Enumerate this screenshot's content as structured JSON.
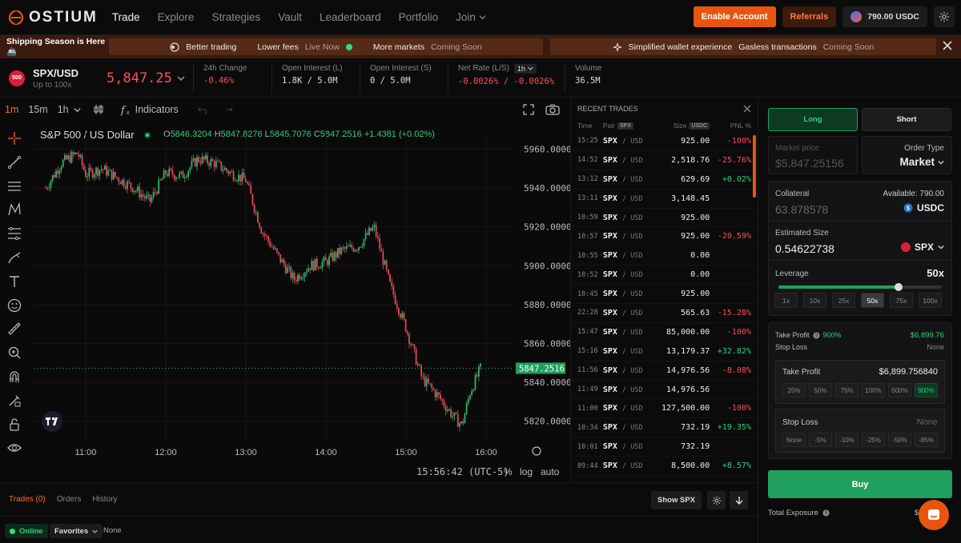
{
  "nav": {
    "logo": "OSTIUM",
    "items": [
      "Trade",
      "Explore",
      "Strategies",
      "Vault",
      "Leaderboard",
      "Portfolio"
    ],
    "join": "Join",
    "enable_account": "Enable Account",
    "referrals": "Referrals",
    "wallet": "790.00 USDC"
  },
  "banner": {
    "left": "Shipping Season is Here 🚢",
    "p1": {
      "a": "Better trading",
      "b": "Lower fees",
      "c": "Live Now",
      "d": "More markets",
      "e": "Coming Soon"
    },
    "p2": {
      "a": "Simplified wallet experience",
      "b": "Gasless transactions",
      "c": "Coming Soon"
    }
  },
  "market": {
    "icon": "500",
    "pair": "SPX/USD",
    "sub": "Up to 100x",
    "price": "5,847.25",
    "stats": [
      {
        "label": "24h Change",
        "value": "-0.46%"
      },
      {
        "label": "Open Interest (L)",
        "value": "1.8K / 5.0M"
      },
      {
        "label": "Open Interest (S)",
        "value": "0 / 5.0M"
      },
      {
        "label": "Net Rate (L/S)",
        "value": "-0.0026% / -0.0026%",
        "badge": "1h"
      },
      {
        "label": "Volume",
        "value": "36.5M"
      }
    ]
  },
  "chart": {
    "timeframes": [
      "1m",
      "15m",
      "1h"
    ],
    "indicators": "Indicators",
    "title": "S&P 500 / US Dollar",
    "ohlc": {
      "o": "5846.3204",
      "h": "5847.8276",
      "l": "5845.7076",
      "c": "5847.2516",
      "chg": "+1.4381 (+0.02%)"
    },
    "last_price": "5847.2516",
    "time": "15:56:42 (UTC-5)",
    "opt_pct": "%",
    "opt_log": "log",
    "opt_auto": "auto"
  },
  "chart_data": {
    "type": "line",
    "title": "S&P 500 / US Dollar",
    "x_ticks": [
      "11:00",
      "12:00",
      "13:00",
      "14:00",
      "15:00",
      "16:00"
    ],
    "y_ticks": [
      5820,
      5840,
      5860,
      5880,
      5900,
      5920,
      5940,
      5960
    ],
    "ylim": [
      5810,
      5968
    ],
    "x": [
      10.5,
      10.7,
      10.9,
      11.0,
      11.2,
      11.4,
      11.6,
      11.8,
      12.0,
      12.2,
      12.4,
      12.6,
      12.8,
      13.0,
      13.2,
      13.4,
      13.6,
      13.8,
      14.0,
      14.2,
      14.4,
      14.6,
      14.8,
      15.0,
      15.2,
      15.4,
      15.6,
      15.7,
      15.8,
      15.93
    ],
    "values": [
      5940,
      5953,
      5958,
      5947,
      5950,
      5945,
      5940,
      5933,
      5948,
      5946,
      5955,
      5953,
      5948,
      5944,
      5918,
      5905,
      5893,
      5900,
      5902,
      5908,
      5910,
      5920,
      5890,
      5868,
      5842,
      5833,
      5822,
      5818,
      5835,
      5847.25
    ],
    "last": 5847.25,
    "grid": true
  },
  "trades": {
    "title": "RECENT TRADES",
    "cols": {
      "time": "Time",
      "pair": "Pair",
      "pair_tag": "SPX",
      "size": "Size",
      "size_tag": "USDC",
      "pnl": "PNL %"
    },
    "rows": [
      {
        "t": "15:25",
        "s": "925.00",
        "p": "-100%",
        "c": "red"
      },
      {
        "t": "14:52",
        "s": "2,518.76",
        "p": "-25.76%",
        "c": "red"
      },
      {
        "t": "13:12",
        "s": "629.69",
        "p": "+0.02%",
        "c": "green"
      },
      {
        "t": "13:11",
        "s": "3,148.45",
        "p": "",
        "c": ""
      },
      {
        "t": "10:59",
        "s": "925.00",
        "p": "",
        "c": ""
      },
      {
        "t": "10:57",
        "s": "925.00",
        "p": "-20.59%",
        "c": "red"
      },
      {
        "t": "10:55",
        "s": "0.00",
        "p": "",
        "c": ""
      },
      {
        "t": "10:52",
        "s": "0.00",
        "p": "",
        "c": ""
      },
      {
        "t": "10:45",
        "s": "925.00",
        "p": "",
        "c": ""
      },
      {
        "t": "22:28",
        "s": "565.63",
        "p": "-15.28%",
        "c": "red"
      },
      {
        "t": "15:47",
        "s": "85,000.00",
        "p": "-100%",
        "c": "red"
      },
      {
        "t": "15:16",
        "s": "13,179.37",
        "p": "+32.82%",
        "c": "green"
      },
      {
        "t": "11:56",
        "s": "14,976.56",
        "p": "-8.08%",
        "c": "red"
      },
      {
        "t": "11:49",
        "s": "14,976.56",
        "p": "",
        "c": ""
      },
      {
        "t": "11:00",
        "s": "127,500.00",
        "p": "-100%",
        "c": "red"
      },
      {
        "t": "10:34",
        "s": "732.19",
        "p": "+19.35%",
        "c": "green"
      },
      {
        "t": "10:01",
        "s": "732.19",
        "p": "",
        "c": ""
      },
      {
        "t": "09:44",
        "s": "8,500.00",
        "p": "+8.57%",
        "c": "green"
      }
    ],
    "pair": "SPX",
    "quote": "/ USD"
  },
  "order": {
    "long": "Long",
    "short": "Short",
    "market_price_label": "Market price",
    "market_price": "$5,847.25156",
    "order_type_label": "Order Type",
    "order_type": "Market",
    "collateral_label": "Collateral",
    "available": "Available: 790.00",
    "collateral": "63.878578",
    "collateral_ccy": "USDC",
    "est_label": "Estimated Size",
    "est": "0.54622738",
    "est_ccy": "SPX",
    "lev_label": "Leverage",
    "lev": "50x",
    "lev_fraction": 0.49,
    "lev_opts": [
      "1x",
      "10x",
      "25x",
      "50x",
      "75x",
      "100x"
    ],
    "tp_label": "Take Profit",
    "tp_pct": "900%",
    "tp_val": "$6,899.76",
    "sl_label": "Stop Loss",
    "sl_val": "None",
    "tp_box_label": "Take Profit",
    "tp_box_val": "$6,899.756840",
    "tp_opts": [
      "25%",
      "50%",
      "75%",
      "100%",
      "500%",
      "900%"
    ],
    "sl_box_label": "Stop Loss",
    "sl_box_val": "None",
    "sl_opts": [
      "None",
      "-5%",
      "-10%",
      "-25%",
      "-50%",
      "-85%"
    ],
    "buy": "Buy",
    "exposure_label": "Total Exposure",
    "exposure_val": "$"
  },
  "bottom": {
    "tabs": [
      "Trades (0)",
      "Orders",
      "History"
    ],
    "show": "Show SPX"
  },
  "status": {
    "online": "Online",
    "fav": "Favorites",
    "none": "None"
  },
  "colors": {
    "accent": "#e8550f",
    "green": "#2fd07a",
    "red": "#ff4d5a"
  }
}
